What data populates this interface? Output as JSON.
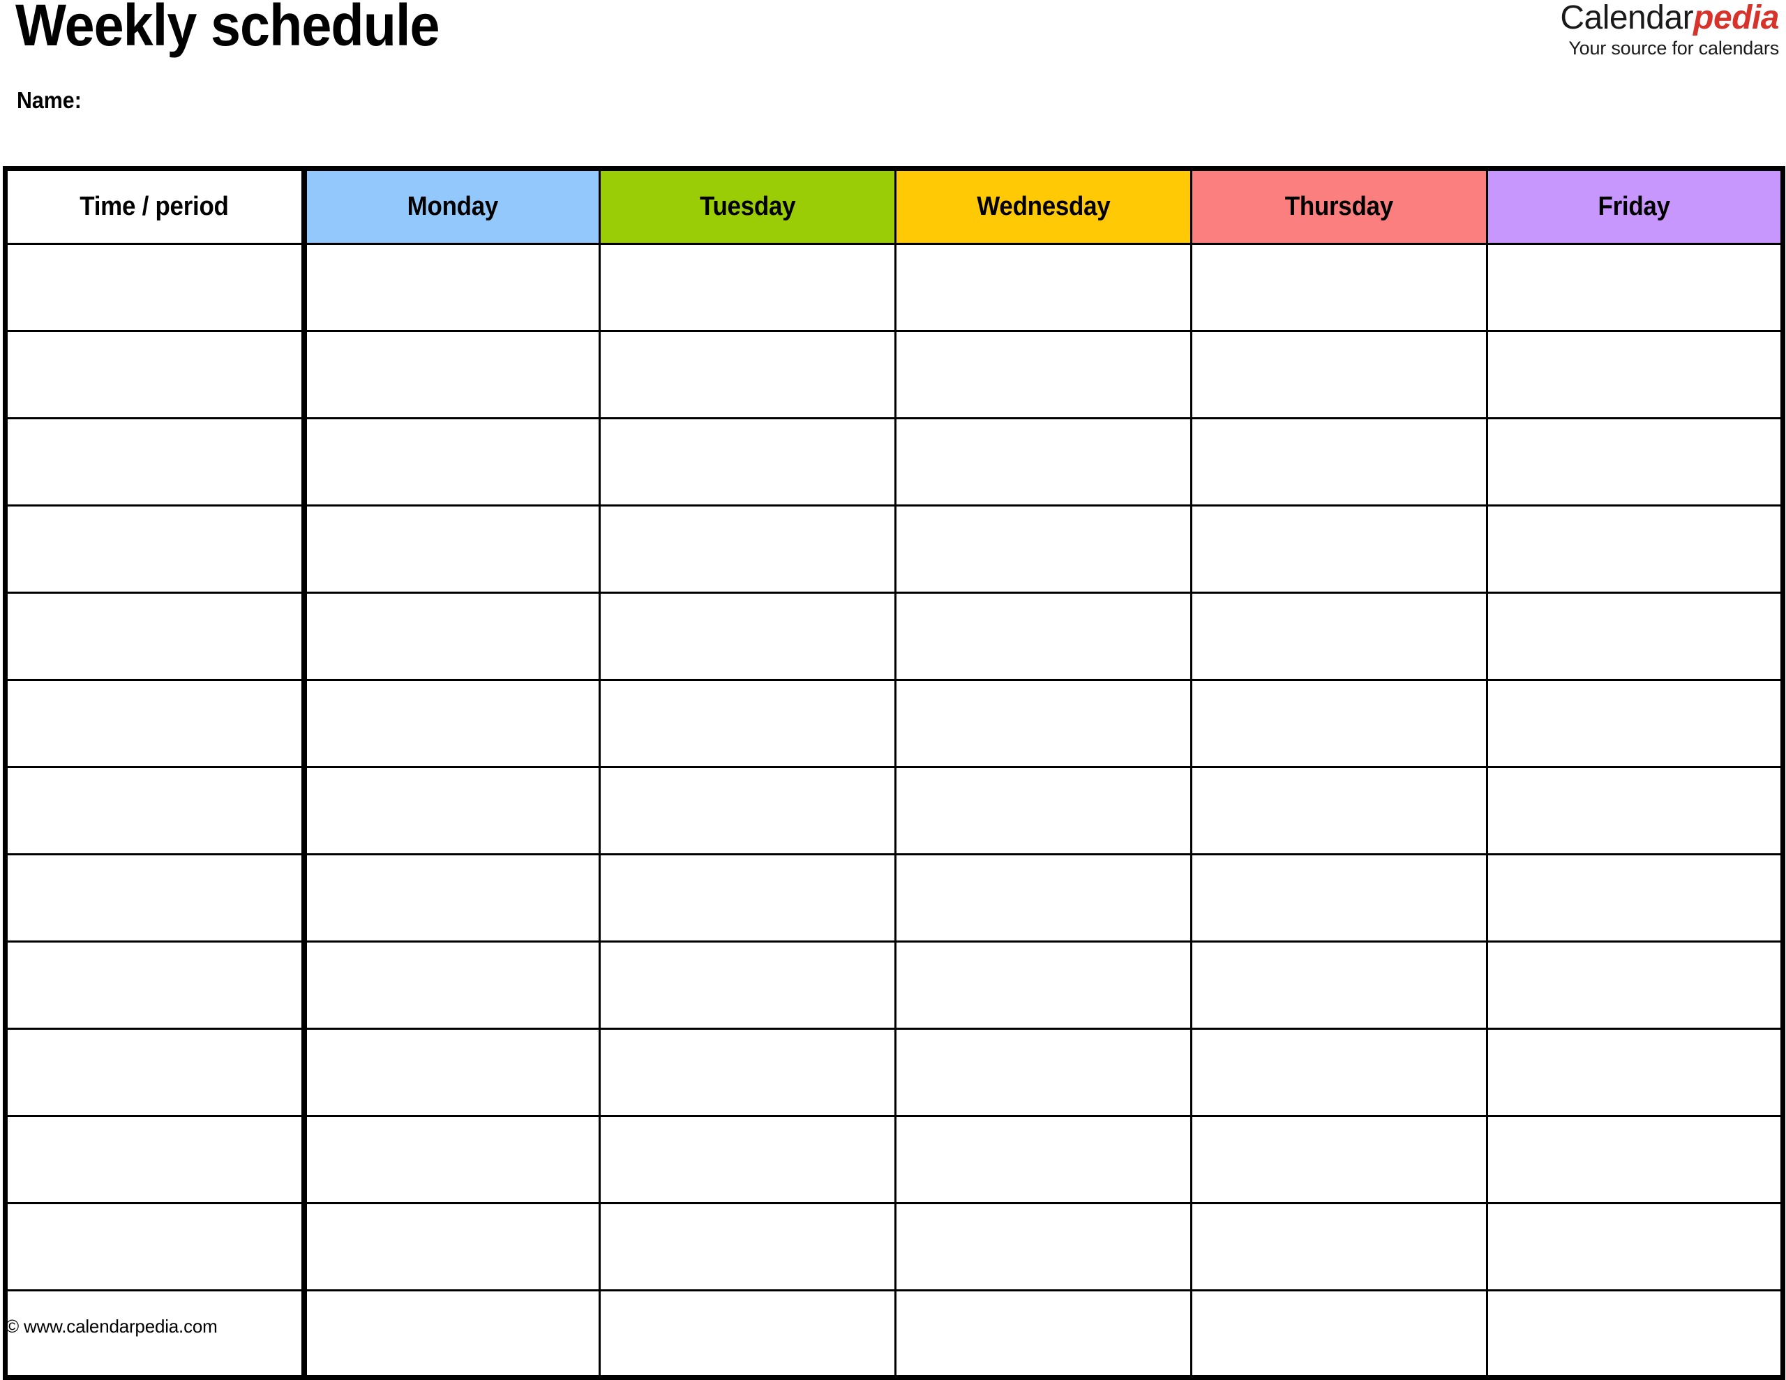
{
  "document": {
    "title": "Weekly schedule",
    "name_label": "Name:"
  },
  "brand": {
    "name_part1": "Calendar",
    "name_part2": "pedia",
    "tagline": "Your source for calendars",
    "accent_color": "#d8332b"
  },
  "table": {
    "columns": [
      {
        "label": "Time / period",
        "bg": "#ffffff"
      },
      {
        "label": "Monday",
        "bg": "#93c8fc"
      },
      {
        "label": "Tuesday",
        "bg": "#9acd05"
      },
      {
        "label": "Wednesday",
        "bg": "#ffc905"
      },
      {
        "label": "Thursday",
        "bg": "#fc7f80"
      },
      {
        "label": "Friday",
        "bg": "#c897fe"
      }
    ],
    "row_count": 13,
    "rows": [
      [
        "",
        "",
        "",
        "",
        "",
        ""
      ],
      [
        "",
        "",
        "",
        "",
        "",
        ""
      ],
      [
        "",
        "",
        "",
        "",
        "",
        ""
      ],
      [
        "",
        "",
        "",
        "",
        "",
        ""
      ],
      [
        "",
        "",
        "",
        "",
        "",
        ""
      ],
      [
        "",
        "",
        "",
        "",
        "",
        ""
      ],
      [
        "",
        "",
        "",
        "",
        "",
        ""
      ],
      [
        "",
        "",
        "",
        "",
        "",
        ""
      ],
      [
        "",
        "",
        "",
        "",
        "",
        ""
      ],
      [
        "",
        "",
        "",
        "",
        "",
        ""
      ],
      [
        "",
        "",
        "",
        "",
        "",
        ""
      ],
      [
        "",
        "",
        "",
        "",
        "",
        ""
      ],
      [
        "",
        "",
        "",
        "",
        "",
        ""
      ]
    ]
  },
  "footer": {
    "copyright": "© www.calendarpedia.com"
  }
}
